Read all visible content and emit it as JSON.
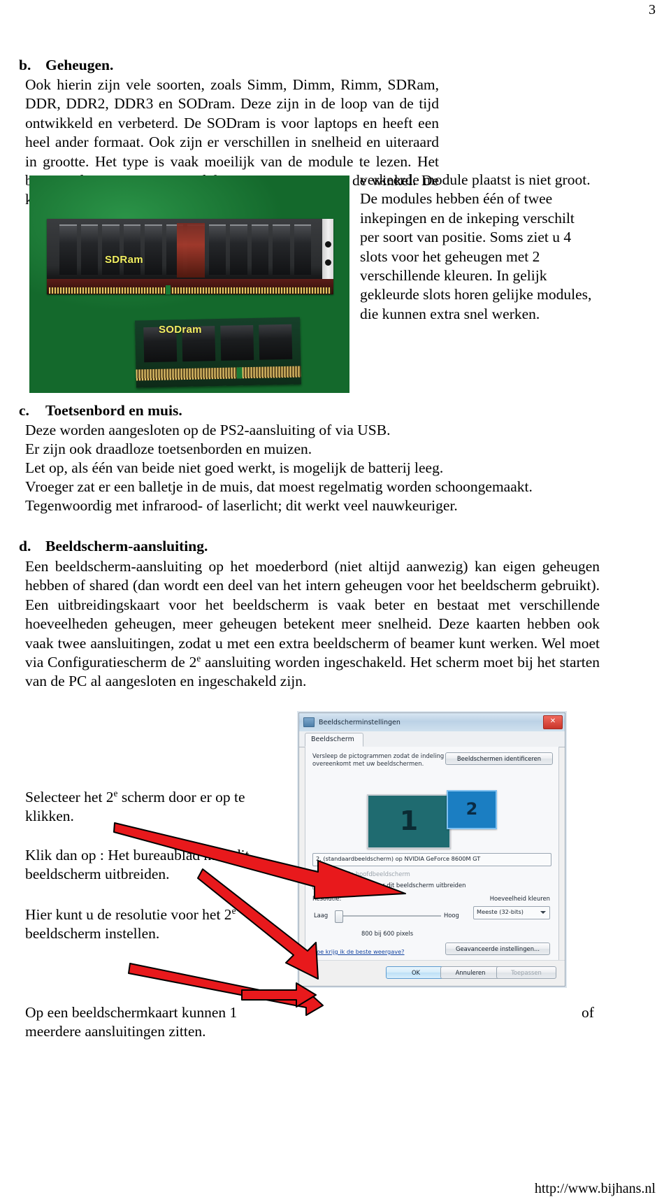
{
  "page": {
    "number": "3",
    "footer_url": "http://www.bijhans.nl"
  },
  "sections": {
    "b": {
      "marker": "b.",
      "heading": "Geheugen.",
      "body_left": "Ook hierin zijn vele soorten, zoals Simm, Dimm, Rimm, SDRam, DDR, DDR2, DDR3 en SODram. Deze zijn in de loop van de tijd ontwikkeld en verbeterd. De SODram is voor laptops en heeft een heel ander formaat. Ook zijn er verschillen in snelheid en uiteraard in grootte. Het type is vaak moeilijk van de module te lezen. Het beste is de te vervangen module mee te nemen naar de winkel. De kans dat u een",
      "body_right": "verkeerde module plaatst is niet groot. De modules hebben één of twee inkepingen en de inkeping verschilt per soort van positie. Soms ziet u 4 slots voor het geheugen met 2 verschillende kleuren. In gelijk gekleurde slots horen gelijke modules, die kunnen extra snel werken."
    },
    "c": {
      "marker": "c.",
      "heading": "Toetsenbord en muis.",
      "lines": [
        "Deze worden aangesloten op de PS2-aansluiting of via USB.",
        "Er zijn ook draadloze toetsenborden en muizen.",
        "Let op, als één van beide niet goed werkt, is mogelijk de batterij leeg.",
        "Vroeger zat er een balletje in de muis, dat moest regelmatig worden schoongemaakt.",
        "Tegenwoordig met infrarood- of laserlicht; dit werkt veel nauwkeuriger."
      ]
    },
    "d": {
      "marker": "d.",
      "heading": "Beeldscherm-aansluiting.",
      "body_part1": "Een beeldscherm-aansluiting op het moederbord (niet altijd aanwezig) kan eigen geheugen hebben of shared (dan wordt een deel van het intern geheugen voor het beeldscherm gebruikt). Een uitbreidingskaart voor het beeldscherm is vaak beter en bestaat met verschillende hoeveelheden geheugen, meer geheugen betekent meer snelheid. Deze kaarten hebben ook vaak twee aansluitingen, zodat u met een extra beeldscherm of beamer kunt werken. Wel moet via Configuratiescherm de 2",
      "body_sup1": "e",
      "body_part2": " aansluiting worden ingeschakeld. Het scherm moet bij het starten van de PC  al aangesloten en ingeschakeld zijn.",
      "callout1_part1": "Selecteer het 2",
      "callout1_sup": "e",
      "callout1_part2": " scherm door er op te klikken.",
      "callout2": "Klik dan op : Het bureaublad naar dit beeldscherm uitbreiden.",
      "callout3_part1": "Hier kunt u de resolutie voor het 2",
      "callout3_sup": "e",
      "callout3_part2": " beeldscherm instellen.",
      "callout4": "Op een beeldschermkaart kunnen 1 meerdere aansluitingen zitten.",
      "callout4_trailing": "of"
    }
  },
  "photo": {
    "caption_sdram": "SDRam",
    "caption_sodram": "SODram",
    "background_color": "#1a7a35",
    "label_color": "#f2ef62"
  },
  "dialog": {
    "title": "Beeldscherminstellingen",
    "close_label": "✕",
    "tab": "Beeldscherm",
    "hint": "Versleep de pictogrammen zodat de indeling overeenkomt met uw beeldschermen.",
    "identify_button": "Beeldschermen identificeren",
    "monitor1": "1",
    "monitor2": "2",
    "monitor1_color": "#1f6b70",
    "monitor2_color": "#1b7ec2",
    "display_select": "2. (standaardbeeldscherm) op NVIDIA GeForce 8600M GT",
    "checkbox_primary": "Dit is mijn hoofdbeeldscherm",
    "checkbox_extend": "Het bureaublad naar dit beeldscherm uitbreiden",
    "label_resolution": "Resolutie:",
    "label_colors": "Hoeveelheid kleuren",
    "label_low": "Laag",
    "label_high": "Hoog",
    "resolution_value": "800 bij 600 pixels",
    "colors_value": "Meeste (32-bits)",
    "link_best_display": "Hoe krijg ik de beste weergave?",
    "advanced_button": "Geavanceerde instellingen...",
    "ok_button": "OK",
    "cancel_button": "Annuleren",
    "apply_button": "Toepassen"
  }
}
